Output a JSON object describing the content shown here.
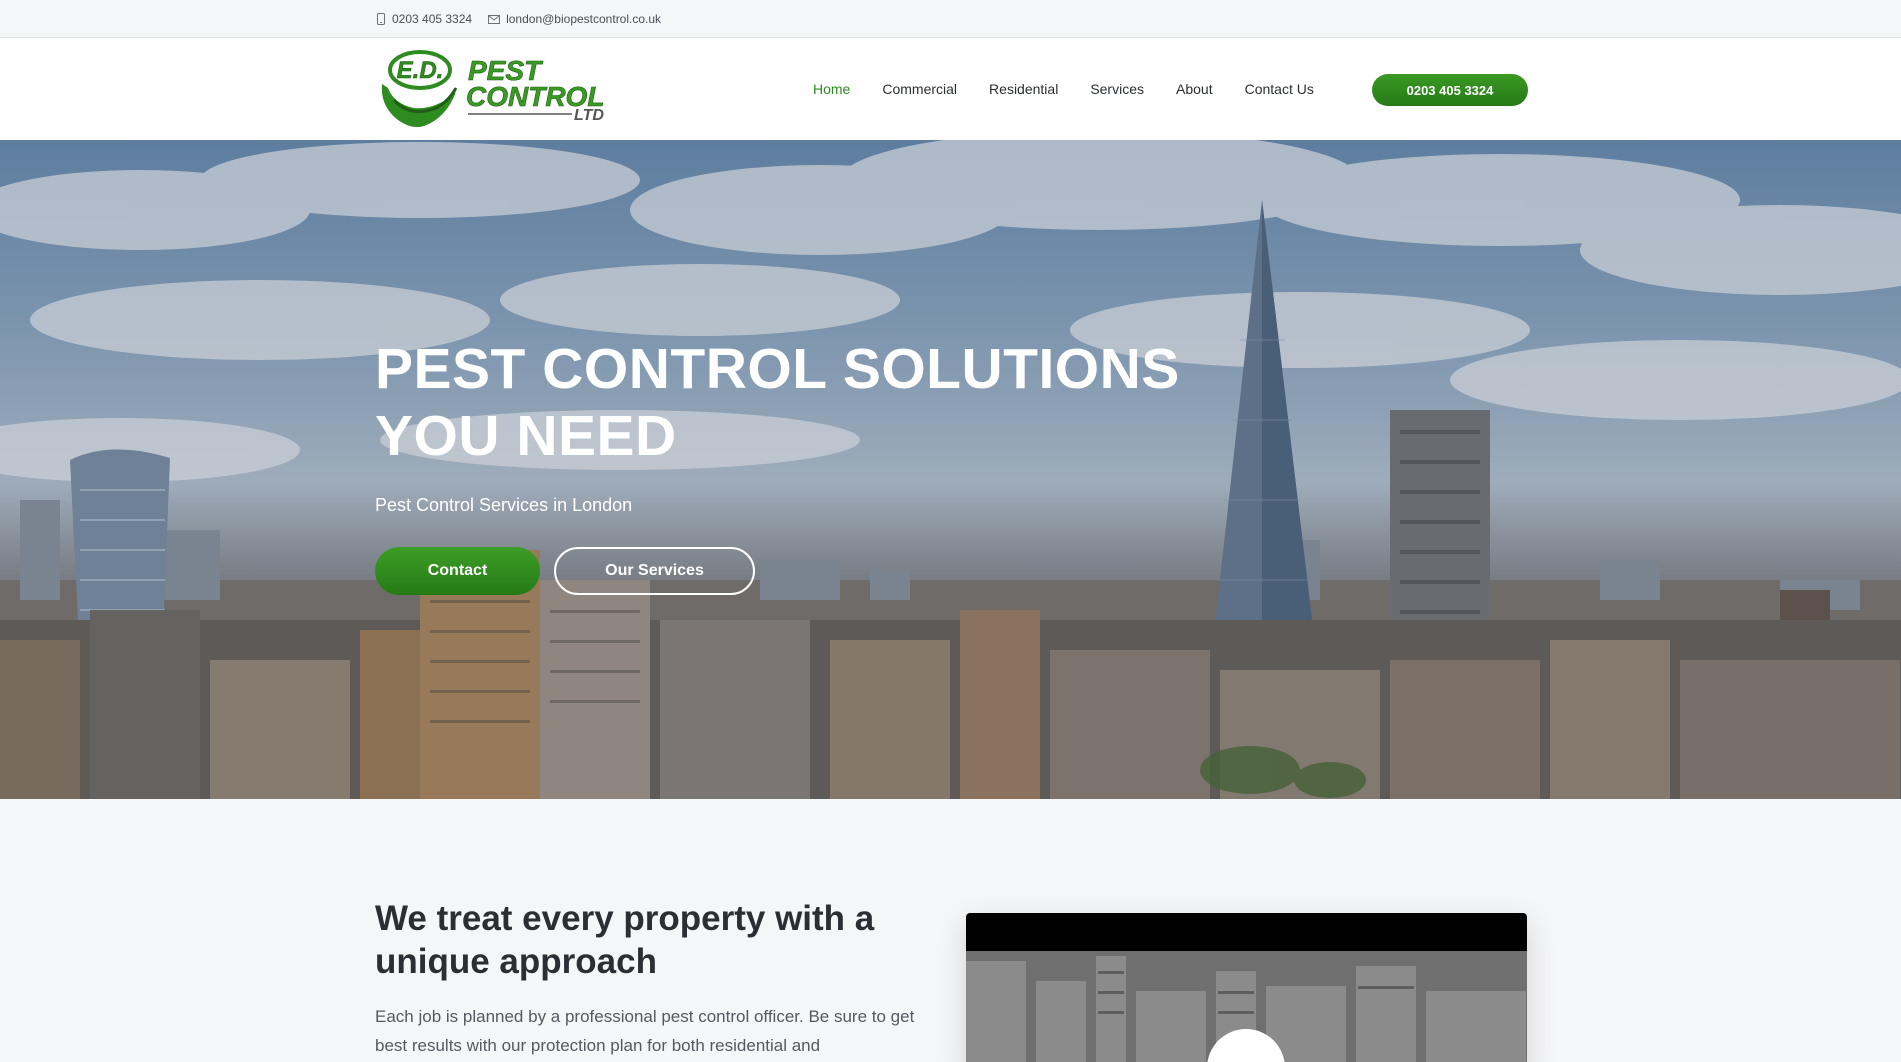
{
  "topbar": {
    "phone": "0203 405 3324",
    "email": "london@biopestcontrol.co.uk",
    "phone_icon": "phone-icon",
    "email_icon": "envelope-icon"
  },
  "logo": {
    "emblem": "E.D.",
    "line1": "PEST",
    "line2": "CONTROL",
    "line3": "LTD"
  },
  "nav": {
    "items": [
      "Home",
      "Commercial",
      "Residential",
      "Services",
      "About",
      "Contact Us"
    ],
    "active": "Home",
    "cta": "0203 405 3324"
  },
  "hero": {
    "title": "PEST CONTROL SOLUTIONS YOU NEED",
    "subtitle": "Pest Control Services in London",
    "contact_label": "Contact",
    "services_label": "Our Services"
  },
  "intro": {
    "title": "We treat every property with a unique approach",
    "text": "Each job is planned by a professional pest control officer. Be sure to get best results with our protection plan for both residential and"
  },
  "colors": {
    "brand_green": "#2e8b1f",
    "button_green": "#3a9a24",
    "text_dark": "#2b2f33",
    "page_bg": "#f5f6f8"
  },
  "video": {
    "play_icon": "play-icon"
  }
}
